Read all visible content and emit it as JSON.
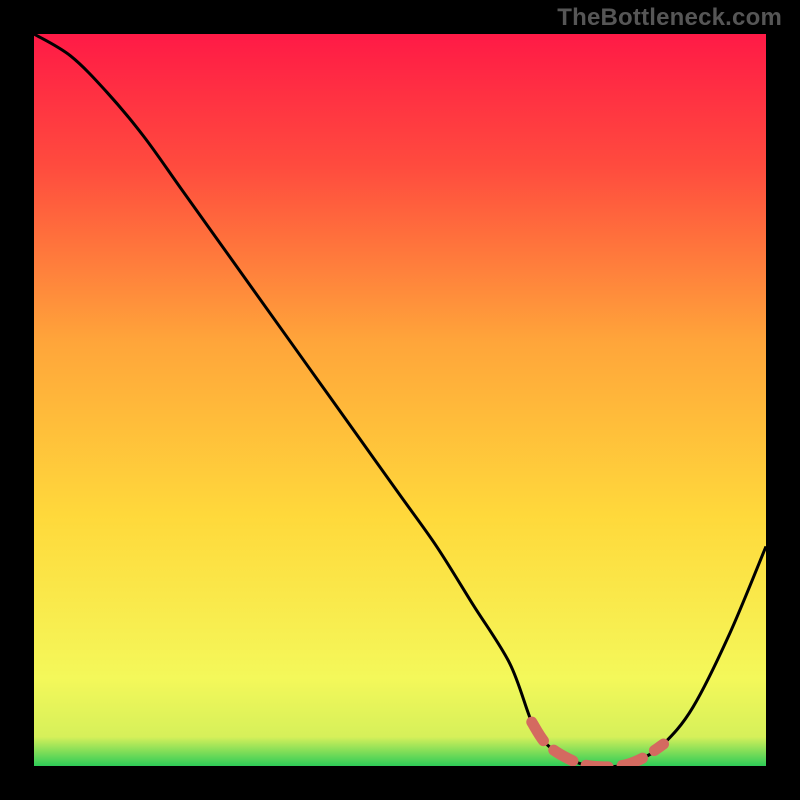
{
  "watermark": "TheBottleneck.com",
  "colors": {
    "background": "#000000",
    "curve": "#000000",
    "highlight": "#d46a60",
    "grad_top": "#ff1a46",
    "grad_mid1": "#ff4b3e",
    "grad_mid2": "#ffa53a",
    "grad_mid3": "#ffd93b",
    "grad_low1": "#f4f85a",
    "grad_low2": "#d6f05a",
    "grad_bottom": "#2ecc57"
  },
  "chart_data": {
    "type": "line",
    "title": "",
    "xlabel": "",
    "ylabel": "",
    "xlim": [
      0,
      100
    ],
    "ylim": [
      0,
      100
    ],
    "series": [
      {
        "name": "bottleneck-curve",
        "x": [
          0,
          5,
          10,
          15,
          20,
          25,
          30,
          35,
          40,
          45,
          50,
          55,
          60,
          65,
          68,
          70,
          73,
          76,
          80,
          83,
          86,
          90,
          95,
          100
        ],
        "y": [
          100,
          97,
          92,
          86,
          79,
          72,
          65,
          58,
          51,
          44,
          37,
          30,
          22,
          14,
          6,
          3,
          1,
          0,
          0,
          1,
          3,
          8,
          18,
          30
        ]
      }
    ],
    "highlight_range": {
      "x_from": 68,
      "x_to": 86,
      "note": "red dashed segment near curve minimum"
    },
    "gradient_bands": [
      {
        "approx_y": 0,
        "color": "#2ecc57"
      },
      {
        "approx_y": 2,
        "color": "#d6f05a"
      },
      {
        "approx_y": 8,
        "color": "#f4f85a"
      },
      {
        "approx_y": 35,
        "color": "#ffd93b"
      },
      {
        "approx_y": 60,
        "color": "#ffa53a"
      },
      {
        "approx_y": 85,
        "color": "#ff4b3e"
      },
      {
        "approx_y": 100,
        "color": "#ff1a46"
      }
    ]
  }
}
